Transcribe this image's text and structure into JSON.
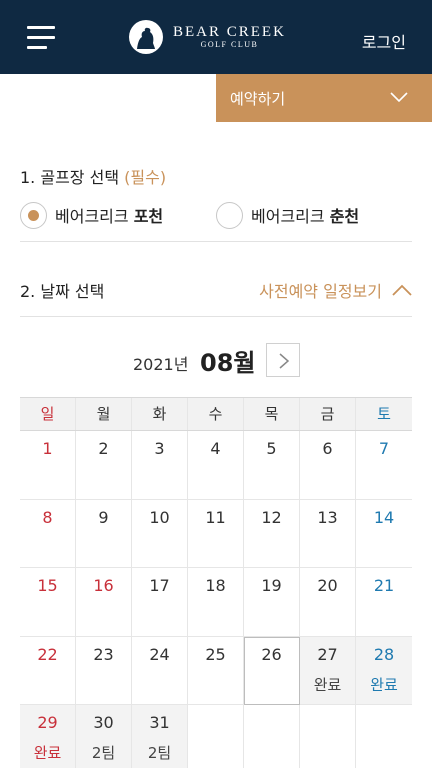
{
  "header": {
    "brand_title": "BEAR CREEK",
    "brand_sub": "GOLF CLUB",
    "login_label": "로그인"
  },
  "reserve": {
    "label": "예약하기"
  },
  "section1": {
    "title": "1. 골프장 선택",
    "required": "(필수)",
    "options": [
      {
        "prefix": "베어크리크",
        "name": "포천",
        "checked": true
      },
      {
        "prefix": "베어크리크",
        "name": "춘천",
        "checked": false
      }
    ]
  },
  "section2": {
    "title": "2. 날짜 선택",
    "schedule_link": "사전예약 일정보기"
  },
  "calendar": {
    "year_label": "2021년",
    "month_label": "08월",
    "weekdays": [
      "일",
      "월",
      "화",
      "수",
      "목",
      "금",
      "토"
    ],
    "days": [
      {
        "d": "1"
      },
      {
        "d": "2"
      },
      {
        "d": "3"
      },
      {
        "d": "4"
      },
      {
        "d": "5"
      },
      {
        "d": "6"
      },
      {
        "d": "7"
      },
      {
        "d": "8"
      },
      {
        "d": "9"
      },
      {
        "d": "10"
      },
      {
        "d": "11"
      },
      {
        "d": "12"
      },
      {
        "d": "13"
      },
      {
        "d": "14"
      },
      {
        "d": "15"
      },
      {
        "d": "16",
        "holiday": true
      },
      {
        "d": "17"
      },
      {
        "d": "18"
      },
      {
        "d": "19"
      },
      {
        "d": "20"
      },
      {
        "d": "21"
      },
      {
        "d": "22"
      },
      {
        "d": "23"
      },
      {
        "d": "24"
      },
      {
        "d": "25"
      },
      {
        "d": "26",
        "today": true
      },
      {
        "d": "27",
        "status": "완료"
      },
      {
        "d": "28",
        "status": "완료"
      },
      {
        "d": "29",
        "status": "완료"
      },
      {
        "d": "30",
        "status": "2팀"
      },
      {
        "d": "31",
        "status": "2팀"
      },
      {
        "d": ""
      },
      {
        "d": ""
      },
      {
        "d": ""
      },
      {
        "d": ""
      }
    ]
  },
  "colors": {
    "header_bg": "#0f2942",
    "accent": "#c9925a",
    "sunday": "#c8303a",
    "saturday": "#1f7ab0"
  }
}
